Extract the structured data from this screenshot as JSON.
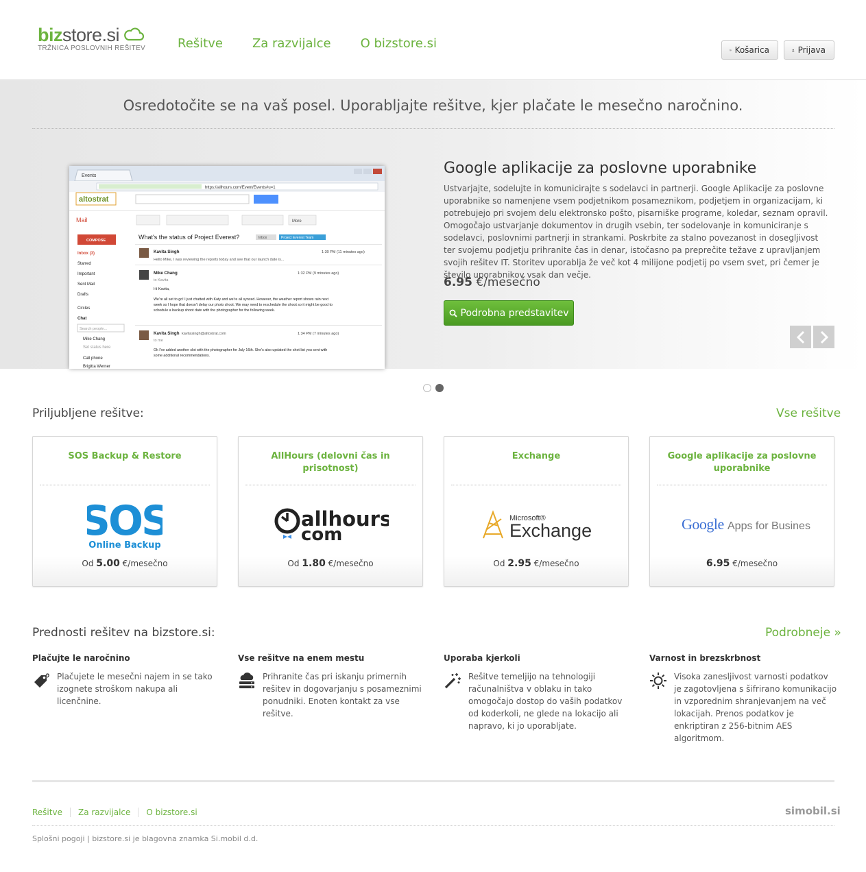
{
  "header": {
    "logo_main": "biz",
    "logo_rest": "store.si",
    "tagline": "TRŽNICA POSLOVNIH REŠITEV",
    "nav": [
      {
        "label": "Rešitve"
      },
      {
        "label": "Za razvijalce"
      },
      {
        "label": "O bizstore.si"
      }
    ],
    "cart_label": "Košarica",
    "login_label": "Prijava"
  },
  "hero": {
    "headline": "Osredotočite se na vaš posel. Uporabljajte rešitve, kjer plačate le mesečno naročnino.",
    "title": "Google aplikacije za poslovne uporabnike",
    "description": "Ustvarjajte, sodelujte in komunicirajte s sodelavci in partnerji. Google Aplikacije za poslovne uporabnike so namenjene vsem podjetnikom posameznikom, podjetjem in organizacijam, ki potrebujejo pri svojem delu elektronsko pošto, pisarniške programe, koledar, seznam opravil. Omogočajo ustvarjanje dokumentov in drugih vsebin, ter sodelovanje in komuniciranje s sodelavci, poslovnimi partnerji in strankami. Poskrbite za stalno povezanost in dosegljivost ter svojemu podjetju prihranite čas in denar, istočasno pa preprečite težave z upravljanjem svojih rešitev IT. Storitev uporablja že več kot 4 milijone podjetij po vsem svet, pri čemer je število uporabnikov vsak dan večje.",
    "price_value": "6.95",
    "price_unit": " €/mesečno",
    "button_label": "Podrobna predstavitev",
    "slides_total": 2,
    "slide_active": 2,
    "screenshot": {
      "tab": "Events",
      "url": "https://allhours.com/Event/Events#u=1",
      "brand": "altostrat",
      "mail": "Mail",
      "compose": "COMPOSE",
      "folders": [
        "Inbox (3)",
        "Starred",
        "Important",
        "Sent Mail",
        "Drafts"
      ],
      "circles": "Circles",
      "chat": "Chat",
      "search_people": "Search people...",
      "contacts": [
        "Mike Chang",
        "Set status here",
        "Call phone",
        "Brigitta Werner"
      ],
      "more": "More",
      "subject": "What's the status of Project Everest?",
      "label_inbox": "Inbox",
      "label_team": "Project Everest Team",
      "messages": [
        {
          "from": "Kavita Singh",
          "time": "1:30 PM (11 minutes ago)",
          "text": "Hello Mike, I was reviewing the reports today and see that our launch date is..."
        },
        {
          "from": "Mike Chang",
          "time": "1:32 PM (9 minutes ago)",
          "to": "to Kavita",
          "greeting": "Hi Kavita,",
          "lines": [
            "We're all set to go! I just chatted with Katy and we're all synced. However, the weather report shows rain next",
            "week so I hope that doesn't delay our photo shoot. We may need to reschedule the shoot so it might be good to",
            "schedule a backup shoot date with the photographer for the following week."
          ]
        },
        {
          "from": "Kavita Singh",
          "email": "kavitasingh@altostrat.com",
          "time": "1:34 PM (7 minutes ago)",
          "to": "to me",
          "lines": [
            "Ok I've added another slot with the photographer for July 16th. She's also updated the shot list you sent with",
            "some additional recommendations."
          ]
        }
      ]
    }
  },
  "featured": {
    "title": "Priljubljene rešitve:",
    "all_link": "Vse rešitve",
    "cards": [
      {
        "title": "SOS Backup & Restore",
        "logo": "SOS",
        "logo_sub": "Online Backup",
        "prefix": "Od ",
        "price": "5.00",
        "unit": " €/mesečno"
      },
      {
        "title": "AllHours (delovni čas in prisotnost)",
        "logo": "allhours.",
        "logo_sub": "com",
        "prefix": "Od ",
        "price": "1.80",
        "unit": " €/mesečno"
      },
      {
        "title": "Exchange",
        "logo": "Exchange",
        "logo_sub": "Microsoft®",
        "prefix": "Od ",
        "price": "2.95",
        "unit": " €/mesečno"
      },
      {
        "title": "Google aplikacije za poslovne uporabnike",
        "logo": "Google",
        "logo_sub": " Apps for Business",
        "prefix": "",
        "price": "6.95",
        "unit": " €/mesečno"
      }
    ]
  },
  "benefits": {
    "title": "Prednosti rešitev na bizstore.si:",
    "more_link": "Podrobneje »",
    "items": [
      {
        "title": "Plačujte le naročnino",
        "text": "Plačujete le mesečni najem in se tako izognete stroškom nakupa ali licenčnine.",
        "icon": "price-tag-icon"
      },
      {
        "title": "Vse rešitve na enem mestu",
        "text": "Prihranite čas pri iskanju primernih rešitev in dogovarjanju s posameznimi ponudniki. Enoten kontakt za vse rešitve.",
        "icon": "cloud-server-icon"
      },
      {
        "title": "Uporaba kjerkoli",
        "text": "Rešitve temeljijo na tehnologiji računalništva v oblaku in tako omogočajo dostop do vaših podatkov od koderkoli, ne glede na lokacijo ali napravo, ki jo uporabljate.",
        "icon": "magic-wand-icon"
      },
      {
        "title": "Varnost in brezskrbnost",
        "text": "Visoka zanesljivost varnosti podatkov je zagotovljena s šifrirano komunikacijo in vzporednim shranjevanjem na več lokacijah. Prenos podatkov je enkriptiran z 256-bitnim AES algoritmom.",
        "icon": "sun-icon"
      }
    ]
  },
  "footer": {
    "nav": [
      "Rešitve",
      "Za razvijalce",
      "O bizstore.si"
    ],
    "brand": "simobil.si",
    "legal": "Splošni pogoji | bizstore.si je blagovna znamka Si.mobil d.d."
  },
  "colors": {
    "brand_green": "#6cb33f",
    "button_green": "#5aab2e",
    "text": "#333333"
  }
}
